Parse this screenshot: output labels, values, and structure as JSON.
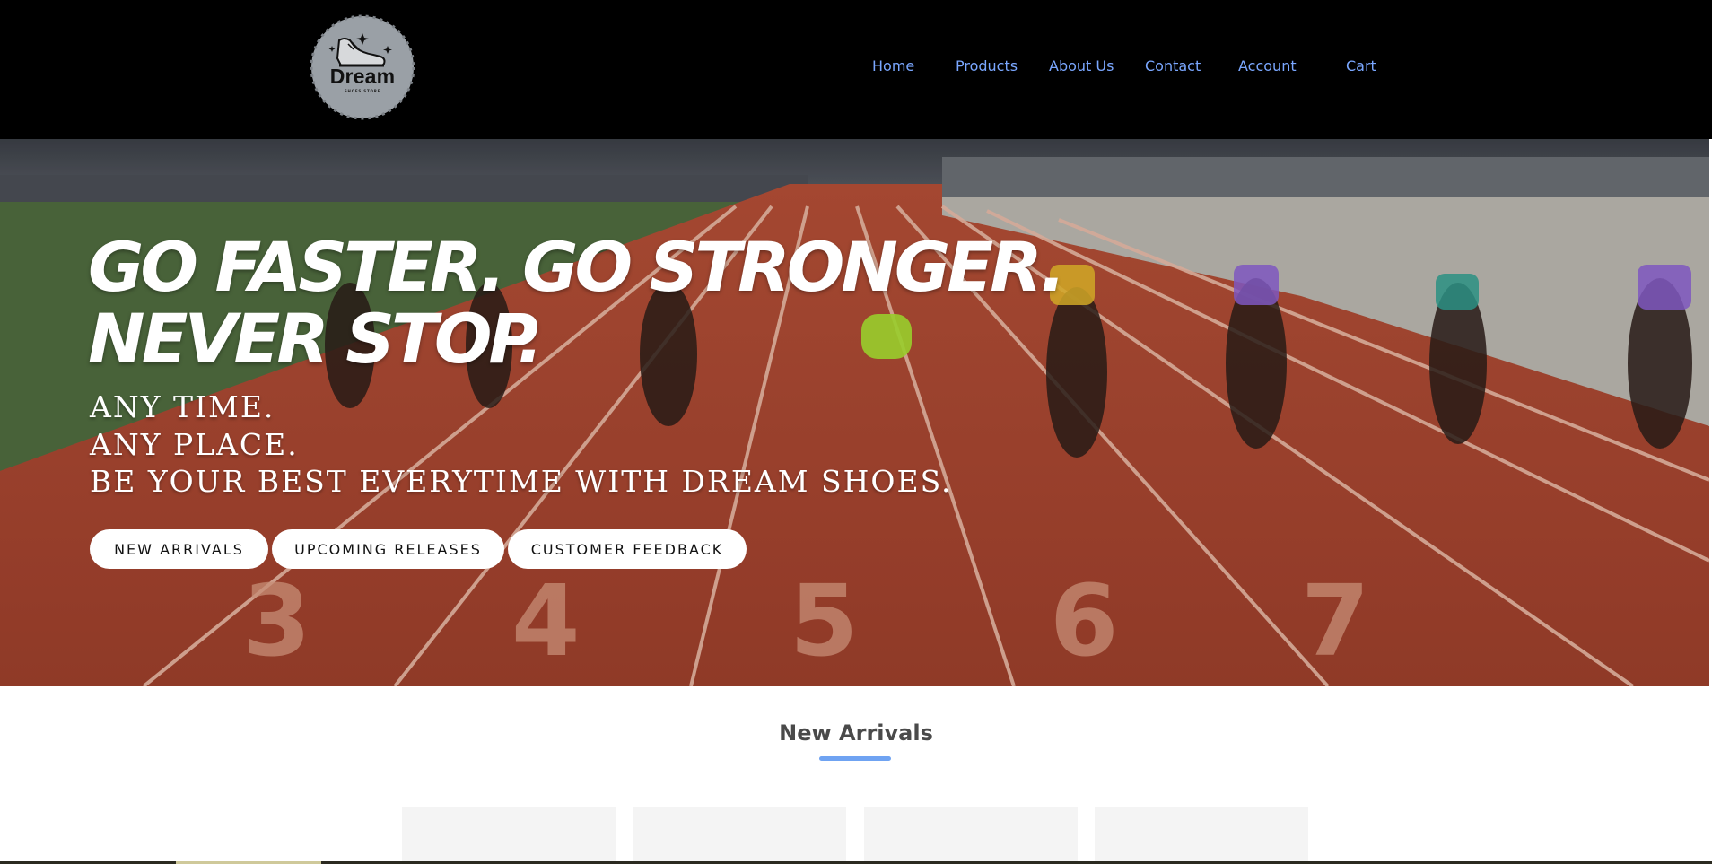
{
  "brand": {
    "logo_text": "Dream",
    "logo_subtext": "SHOES STORE"
  },
  "nav": {
    "home": "Home",
    "products": "Products",
    "about": "About Us",
    "contact": "Contact",
    "account": "Account",
    "cart": "Cart"
  },
  "hero": {
    "headline_line1": "GO FASTER. GO STRONGER.",
    "headline_line2": "NEVER STOP.",
    "tagline_line1": "ANY TIME.",
    "tagline_line2": "ANY PLACE.",
    "tagline_line3": "BE YOUR BEST EVERYTIME WITH DREAM SHOES.",
    "buttons": {
      "new_arrivals": "NEW ARRIVALS",
      "upcoming_releases": "UPCOMING RELEASES",
      "customer_feedback": "CUSTOMER FEEDBACK"
    },
    "lane_numbers": [
      "3",
      "4",
      "5",
      "6",
      "7"
    ]
  },
  "new_arrivals": {
    "title": "New Arrivals"
  },
  "colors": {
    "header_bg": "#000000",
    "nav_link": "#7aa7ff",
    "track": "#a3452e",
    "accent_underline": "#6fa3f2",
    "section_title": "#4a4a4a"
  }
}
